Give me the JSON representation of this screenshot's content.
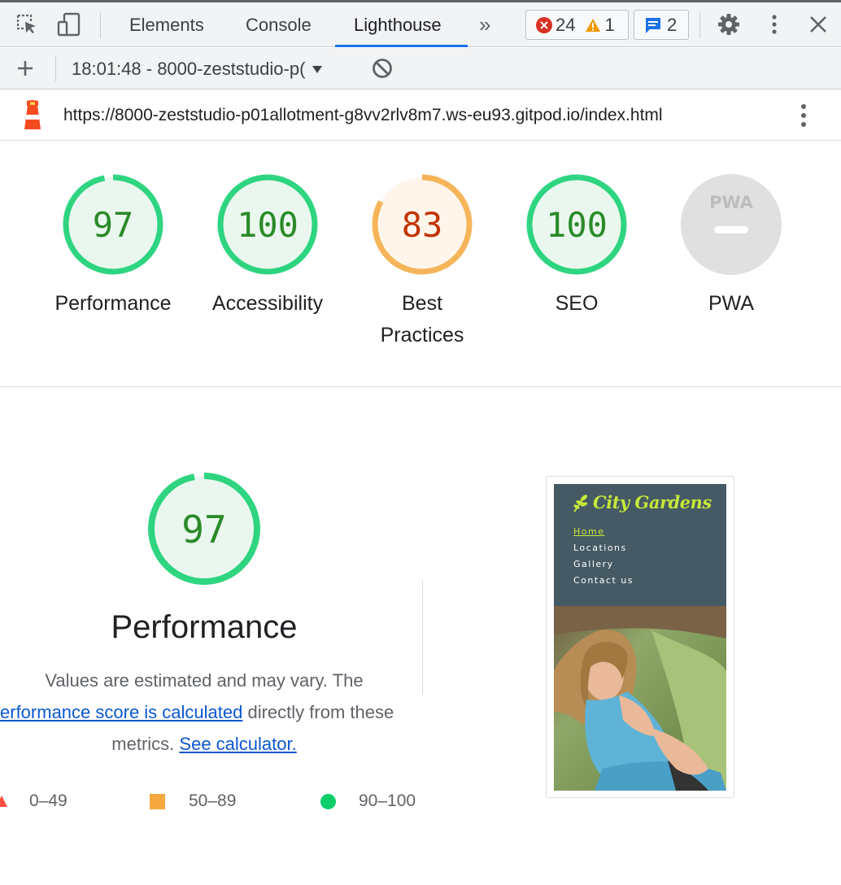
{
  "toolbar": {
    "tabs": [
      {
        "label": "Elements"
      },
      {
        "label": "Console"
      },
      {
        "label": "Lighthouse"
      }
    ],
    "errors_count": "24",
    "warnings_count": "1",
    "messages_count": "2"
  },
  "report": {
    "selected": "18:01:48 - 8000-zeststudio-p("
  },
  "url": {
    "text": "https://8000-zeststudio-p01allotment-g8vv2rlv8m7.ws-eu93.gitpod.io/index.html"
  },
  "gauges": [
    {
      "score": "97",
      "label": "Performance",
      "value": 0.97,
      "status": "pass"
    },
    {
      "score": "100",
      "label": "Accessibility",
      "value": 1.0,
      "status": "pass"
    },
    {
      "score": "83",
      "label_line1": "Best",
      "label_line2": "Practices",
      "value": 0.83,
      "status": "average"
    },
    {
      "score": "100",
      "label": "SEO",
      "value": 1.0,
      "status": "pass"
    },
    {
      "score": "",
      "label": "PWA",
      "badge": "PWA"
    }
  ],
  "colors": {
    "pass": "#0cce6b",
    "pass_text": "#2a8a28",
    "pass_fill": "#eaf7ee",
    "average": "#f4a83e",
    "average_text": "#c33300",
    "average_fill": "#fff5ea",
    "fail": "#ff4e42",
    "link": "#0b57d0",
    "accent": "#1a73e8"
  },
  "performance": {
    "score": "97",
    "value": 0.97,
    "title": "Performance",
    "desc_prefix": "Values are estimated and may vary. The",
    "desc_link": "performance score is calculated",
    "desc_mid": "directly from these metrics.",
    "desc_link2": "See calculator.",
    "legend": [
      {
        "range": "0–49"
      },
      {
        "range": "50–89"
      },
      {
        "range": "90–100"
      }
    ]
  },
  "thumbnail": {
    "brand": "City Gardens",
    "nav": [
      "Home",
      "Locations",
      "Gallery",
      "Contact us"
    ]
  }
}
